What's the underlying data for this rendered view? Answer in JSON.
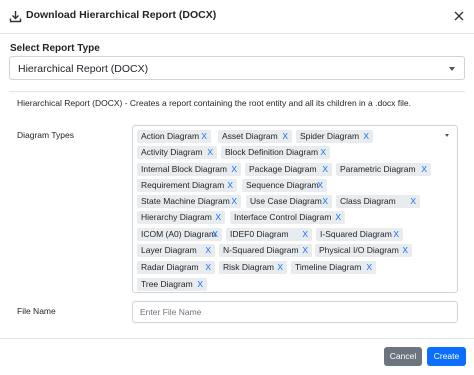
{
  "header": {
    "title": "Download Hierarchical Report (DOCX)",
    "download_icon": "download-icon",
    "close_icon": "close-icon"
  },
  "report_type": {
    "label": "Select Report Type",
    "selected": "Hierarchical Report (DOCX)"
  },
  "description": "Hierarchical Report (DOCX) - Creates a report containing the root entity and all its children in a .docx file.",
  "diagram_types": {
    "label": "Diagram Types",
    "remove_glyph": "X",
    "chips": [
      "Action Diagram",
      "Asset Diagram",
      "Spider Diagram",
      "Activity Diagram",
      "Block Definition Diagram",
      "Internal Block Diagram",
      "Package Diagram",
      "Parametric Diagram",
      "Requirement Diagram",
      "Sequence Diagram",
      "State Machine Diagram",
      "Use Case Diagram",
      "Class Diagram",
      "Hierarchy Diagram",
      "Interface Control Diagram",
      "ICOM (A0) Diagram",
      "IDEF0 Diagram",
      "I-Squared Diagram",
      "Layer Diagram",
      "N-Squared Diagram",
      "Physical I/O Diagram",
      "Radar Diagram",
      "Risk Diagram",
      "Timeline Diagram",
      "Tree Diagram"
    ]
  },
  "file_name": {
    "label": "File Name",
    "placeholder": "Enter File Name",
    "value": ""
  },
  "buttons": {
    "cancel": "Cancel",
    "create": "Create"
  },
  "colors": {
    "accent": "#0d6efd",
    "cancel": "#6c757d",
    "chip_bg": "#e9ecef"
  }
}
